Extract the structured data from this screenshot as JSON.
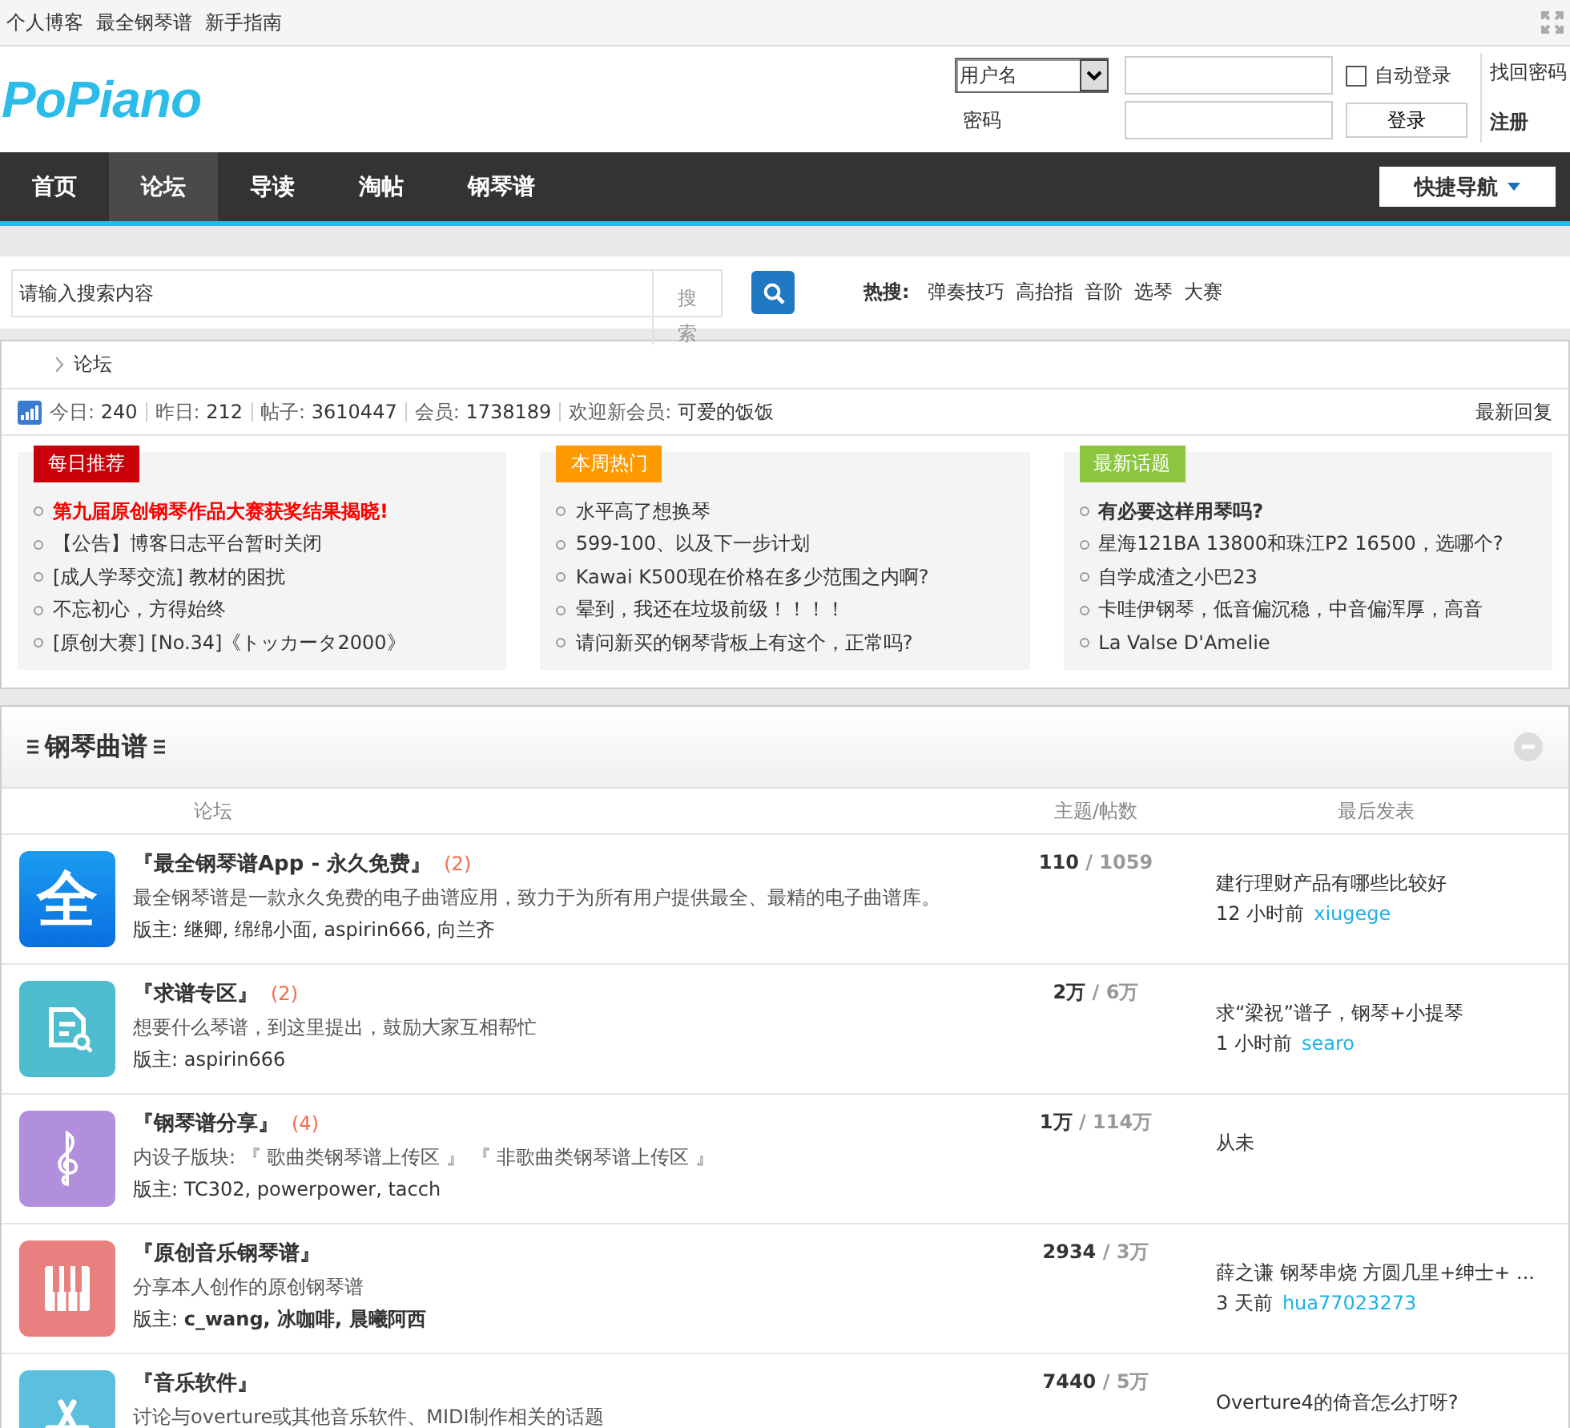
{
  "top_links": [
    "个人博客",
    "最全钢琴谱",
    "新手指南"
  ],
  "logo": "PoPiano",
  "login": {
    "account_type": "用户名",
    "password_label": "密码",
    "auto_login_label": "自动登录",
    "auto_login_checked": false,
    "login_button": "登录",
    "forgot": "找回密码",
    "register": "注册"
  },
  "nav": {
    "items": [
      {
        "label": "首页",
        "selected": false
      },
      {
        "label": "论坛",
        "selected": true
      },
      {
        "label": "导读",
        "selected": false
      },
      {
        "label": "淘帖",
        "selected": false
      },
      {
        "label": "钢琴谱",
        "selected": false
      }
    ],
    "quick_nav": "快捷导航"
  },
  "search": {
    "placeholder": "请输入搜索内容",
    "type_label": "搜索",
    "hot_label": "热搜:",
    "hot": [
      "弹奏技巧",
      "高抬指",
      "音阶",
      "选琴",
      "大赛"
    ]
  },
  "breadcrumb": "论坛",
  "stats": [
    {
      "label": "今日:",
      "value": "240"
    },
    {
      "label": "昨日:",
      "value": "212"
    },
    {
      "label": "帖子:",
      "value": "3610447"
    },
    {
      "label": "会员:",
      "value": "1738189"
    },
    {
      "label": "欢迎新会员:",
      "value": "可爱的饭饭"
    }
  ],
  "latest_replies": "最新回复",
  "featured": [
    {
      "title": "每日推荐",
      "color": "#c8000a",
      "items": [
        {
          "text": "第九届原创钢琴作品大赛获奖结果揭晓!",
          "kind": "red"
        },
        {
          "text": "【公告】博客日志平台暂时关闭",
          "kind": "plain"
        },
        {
          "text": "[成人学琴交流] 教材的困扰",
          "kind": "plain"
        },
        {
          "text": "不忘初心，方得始终",
          "kind": "plain"
        },
        {
          "text": "[原创大赛] [No.34]《トッカータ2000》",
          "kind": "plain"
        }
      ]
    },
    {
      "title": "本周热门",
      "color": "#ff9900",
      "items": [
        {
          "text": "水平高了想换琴",
          "kind": "plain"
        },
        {
          "text": "599-100、以及下一步计划",
          "kind": "plain"
        },
        {
          "text": "Kawai K500现在价格在多少范围之内啊?",
          "kind": "plain"
        },
        {
          "text": "晕到，我还在垃圾前级！！！！",
          "kind": "plain"
        },
        {
          "text": "请问新买的钢琴背板上有这个，正常吗?",
          "kind": "plain"
        }
      ]
    },
    {
      "title": "最新话题",
      "color": "#8cc63f",
      "items": [
        {
          "text": "有必要这样用琴吗?",
          "kind": "bold"
        },
        {
          "text": "星海121BA 13800和珠江P2 16500，选哪个?",
          "kind": "plain"
        },
        {
          "text": "自学成渣之小巴23",
          "kind": "plain"
        },
        {
          "text": "卡哇伊钢琴，低音偏沉稳，中音偏浑厚，高音",
          "kind": "plain"
        },
        {
          "text": "La Valse D'Amelie",
          "kind": "plain"
        }
      ]
    }
  ],
  "section": {
    "title": "钢琴曲谱",
    "columns": [
      "论坛",
      "主题/帖数",
      "最后发表"
    ],
    "forums": [
      {
        "name": "『最全钢琴谱App - 永久免费』",
        "new_count": "(2)",
        "icon": {
          "kind": "glyph",
          "text": "全",
          "color": "#1a9cf0"
        },
        "description": "最全钢琴谱是一款永久免费的电子曲谱应用，致力于为所有用户提供最全、最精的电子曲谱库。",
        "moderators": "版主: 继卿, 绵绵小面, aspirin666, 向兰齐",
        "topics": "110",
        "posts": "/ 1059",
        "last_post": {
          "title": "建行理财产品有哪些比较好",
          "time": "12 小时前",
          "user": "xiugege"
        }
      },
      {
        "name": "『求谱专区』",
        "new_count": "(2)",
        "icon": {
          "kind": "search-doc",
          "color": "#4dbccf"
        },
        "description": "想要什么琴谱，到这里提出，鼓励大家互相帮忙",
        "moderators": "版主: aspirin666",
        "topics": "2万",
        "posts": "/ 6万",
        "last_post": {
          "title": "求“梁祝”谱子，钢琴+小提琴",
          "time": "1 小时前",
          "user": "searo"
        }
      },
      {
        "name": "『钢琴谱分享』",
        "new_count": "(4)",
        "icon": {
          "kind": "clef",
          "color": "#b28fdc"
        },
        "description": "内设子版块: 『 歌曲类钢琴谱上传区 』 『 非歌曲类钢琴谱上传区 』",
        "moderators": "版主: TC302, powerpower, tacch",
        "topics": "1万",
        "posts": "/ 114万",
        "last_post": {
          "title": "从未"
        }
      },
      {
        "name": "『原创音乐钢琴谱』",
        "icon": {
          "kind": "piano",
          "color": "#e88080"
        },
        "description": "分享本人创作的原创钢琴谱",
        "moderators": "版主: **c_wang, 冰咖啡, 晨曦阿西**",
        "topics": "2934",
        "posts": "/ 3万",
        "last_post": {
          "title": "薛之谦  钢琴串烧  方圆几里+绅士+ ...",
          "time": "3 天前",
          "user": "hua77023273"
        }
      },
      {
        "name": "『音乐软件』",
        "icon": {
          "kind": "app",
          "color": "#5bc0de"
        },
        "description": "讨论与overture或其他音乐软件、MIDI制作相关的话题",
        "topics": "7440",
        "posts": "/ 5万",
        "last_post": {
          "title": "Overture4的倚音怎么打呀?"
        }
      }
    ]
  }
}
